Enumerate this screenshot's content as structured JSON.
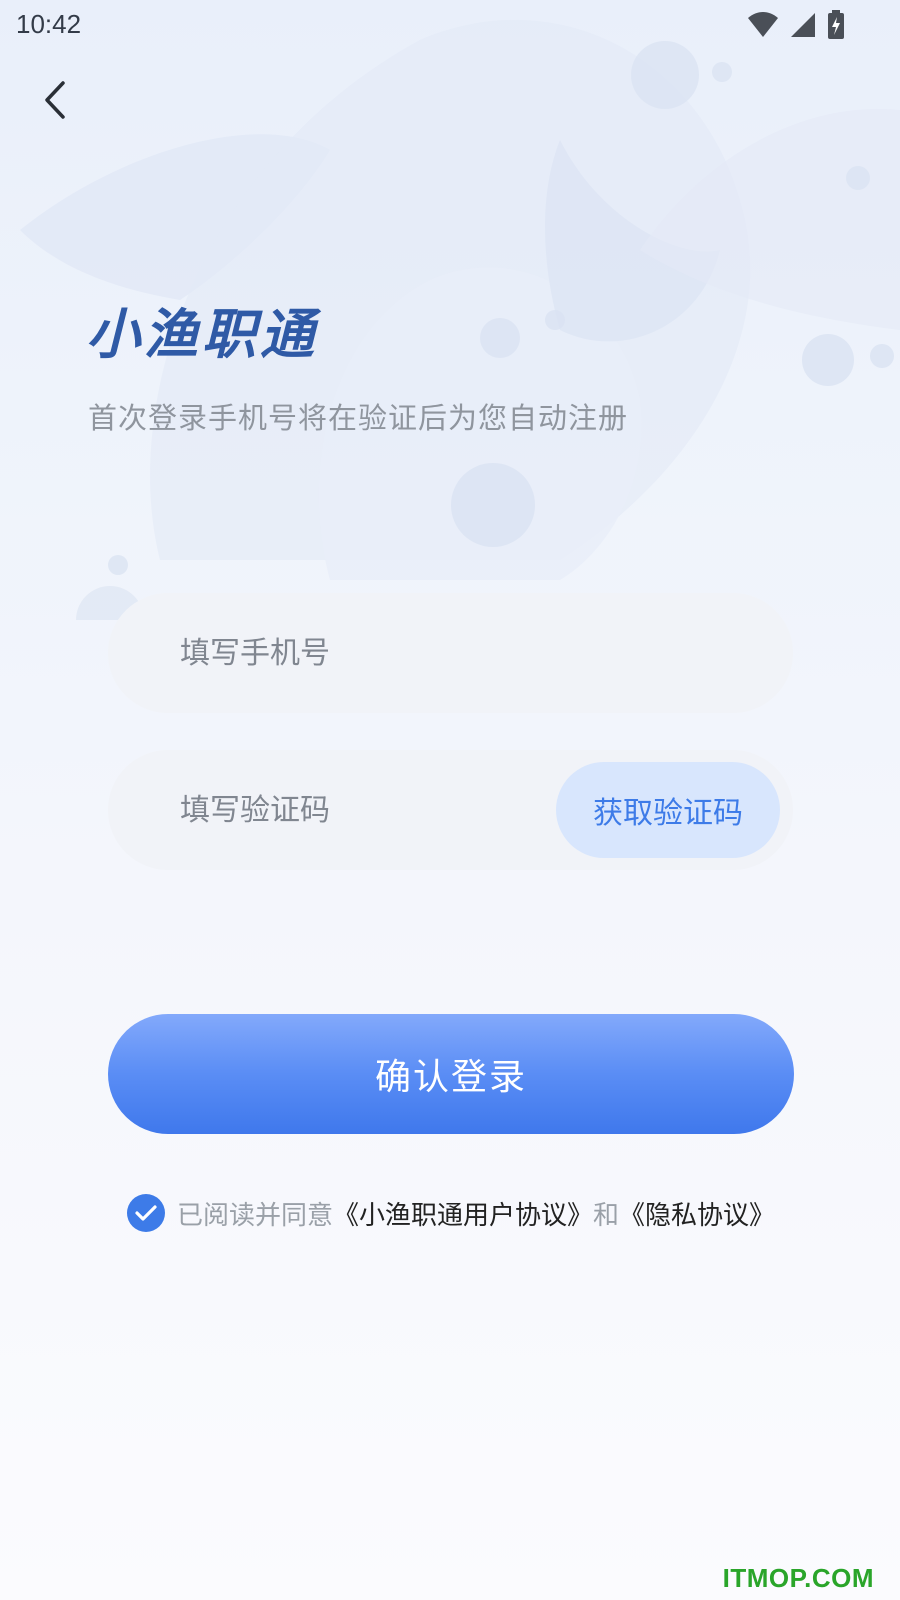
{
  "status_bar": {
    "time": "10:42"
  },
  "header": {
    "logo_text": "小渔职通",
    "subtitle": "首次登录手机号将在验证后为您自动注册"
  },
  "form": {
    "phone": {
      "value": "",
      "placeholder": "填写手机号"
    },
    "code": {
      "value": "",
      "placeholder": "填写验证码",
      "get_code_label": "获取验证码"
    },
    "submit_label": "确认登录"
  },
  "agreement": {
    "checked": true,
    "prefix": "已阅读并同意",
    "user_agreement": "《小渔职通用户协议》",
    "joiner": "和",
    "privacy": "《隐私协议》"
  },
  "watermark": "ITMOP.COM",
  "colors": {
    "accent": "#3d7be8",
    "brand": "#2f5aa6",
    "watermark": "#2aa52a"
  }
}
